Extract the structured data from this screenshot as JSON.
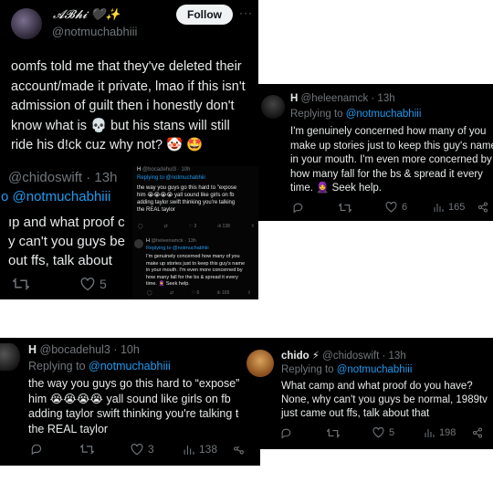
{
  "colors": {
    "background": "#000000",
    "text": "#e7e9ea",
    "muted": "#71767b",
    "link": "#1d9bf0"
  },
  "main_post": {
    "display_name": "𝓐𝓑𝓱𝓲 🖤✨",
    "handle": "@notmuchabhiii",
    "follow_label": "Follow",
    "more_label": "···",
    "body_lines": [
      "oomfs told me that they've deleted their",
      "account/made it private, lmao if this isn't",
      "admission of guilt then i honestly don't",
      "know what is 💀 but his stans will still",
      "ride his d!ck cuz why not? 🤡 🤩"
    ]
  },
  "crop_chido": {
    "header": "@chidoswift · 13h",
    "reply_line": "o @notmuchabhiii",
    "lines": [
      "ıp and what proof c",
      "y can't you guys be",
      "out ffs, talk about"
    ],
    "like_count": "5"
  },
  "embedded_bocade": {
    "name": "H",
    "meta": "@bocadehul3 · 10h",
    "replying": "Replying to @notmuchabhiii",
    "lines": [
      "the way you guys go this hard to \"expose",
      "him 😭😭😭😭 yall sound like girls on fb",
      "adding taylor swift thinking you're talking",
      "the REAL taylor"
    ],
    "like_count": "3",
    "view_count": "138"
  },
  "embedded_heleen": {
    "name": "H",
    "meta": "@heleenamck · 13h",
    "replying": "Replying to @notmuchabhiii",
    "lines": [
      "I'm genuinely concerned how many of you",
      "make up stories just to keep this guy's name",
      "in your mouth. I'm even more concerned by",
      "how many fall for the bs & spread it every",
      "time. 🧕 Seek help."
    ],
    "like_count": "6",
    "view_count": "165"
  },
  "heleen_reply": {
    "name": "H",
    "meta": "@heleenamck · 13h",
    "replying_prefix": "Replying to ",
    "replying_handle": "@notmuchabhiii",
    "lines": [
      "I'm genuinely concerned how many of you",
      "make up stories just to keep this guy's name",
      "in your mouth. I'm even more concerned by",
      "how many fall for the bs & spread it every",
      "time. 🧕 Seek help."
    ],
    "like_count": "6",
    "view_count": "165"
  },
  "bocade_reply": {
    "name": "H",
    "meta": "@bocadehul3 · 10h",
    "replying_prefix": "Replying to ",
    "replying_handle": "@notmuchabhiii",
    "lines": [
      "the way you guys go this hard to “expose”",
      "him 😭😭😭😭 yall sound like girls on fb",
      "adding taylor swift thinking you're talking to",
      "the REAL taylor"
    ],
    "like_count": "3",
    "view_count": "138"
  },
  "chido_reply": {
    "name": "chido ⚡",
    "meta": "@chidoswift · 13h",
    "replying_prefix": "Replying to ",
    "replying_handle": "@notmuchabhiii",
    "lines": [
      "What camp and what proof do you have?",
      "None, why can't you guys be normal, 1989tv",
      "just came out ffs, talk about that"
    ],
    "like_count": "5",
    "view_count": "198"
  }
}
